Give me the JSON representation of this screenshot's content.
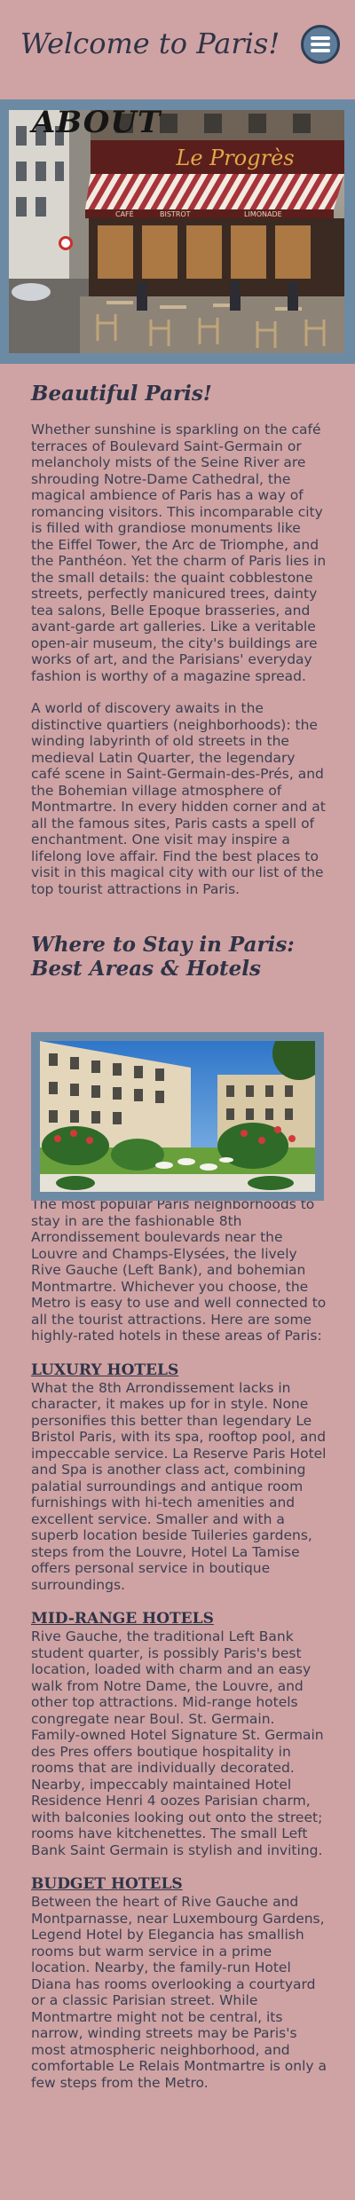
{
  "header": {
    "title": "Welcome to Paris!"
  },
  "hero": {
    "label": "ABOUT"
  },
  "sections": {
    "beautiful": {
      "heading": "Beautiful Paris!",
      "p1": "Whether sunshine is sparkling on the café terraces of Boulevard Saint-Germain or melancholy mists of the Seine River are shrouding Notre-Dame Cathedral, the magical ambience of Paris has a way of romancing visitors. This incomparable city is filled with grandiose monuments like the Eiffel Tower, the Arc de Triomphe, and the Panthéon. Yet the charm of Paris lies in the small details: the quaint cobblestone streets, perfectly manicured trees, dainty tea salons, Belle Epoque brasseries, and avant-garde art galleries. Like a veritable open-air museum, the city's buildings are works of art, and the Parisians' everyday fashion is worthy of a magazine spread.",
      "p2": "A world of discovery awaits in the distinctive quartiers (neighborhoods): the winding labyrinth of old streets in the medieval Latin Quarter, the legendary café scene in Saint-Germain-des-Prés, and the Bohemian village atmosphere of Montmartre. In every hidden corner and at all the famous sites, Paris casts a spell of enchantment. One visit may inspire a lifelong love affair. Find the best places to visit in this magical city with our list of the top tourist attractions in Paris."
    },
    "stay": {
      "heading_line1": "Where to Stay in Paris:",
      "heading_line2": "Best Areas & Hotels",
      "intro": "The most popular Paris neighborhoods to stay in are the fashionable 8th Arrondissement boulevards near the Louvre and Champs-Elysées, the lively Rive Gauche (Left Bank), and bohemian Montmartre. Whichever you choose, the Metro is easy to use and well connected to all the tourist attractions. Here are some highly-rated hotels in these areas of Paris:",
      "luxury_heading": "LUXURY HOTELS",
      "luxury_text": "What the 8th Arrondissement lacks in character, it makes up for in style. None personifies this better than legendary Le Bristol Paris, with its spa, rooftop pool, and impeccable service. La Reserve Paris Hotel and Spa is another class act, combining palatial surroundings and antique room furnishings with hi-tech amenities and excellent service. Smaller and with a superb location beside Tuileries gardens, steps from the Louvre, Hotel La Tamise offers personal service in boutique surroundings.",
      "midrange_heading": "MID-RANGE HOTELS",
      "midrange_text": "Rive Gauche, the traditional Left Bank student quarter, is possibly Paris's best location, loaded with charm and an easy walk from Notre Dame, the Louvre, and other top attractions. Mid-range hotels congregate near Boul. St. Germain. Family-owned Hotel Signature St. Germain des Pres offers boutique hospitality in rooms that are individually decorated. Nearby, impeccably maintained Hotel Residence Henri 4 oozes Parisian charm, with balconies looking out onto the street; rooms have kitchenettes. The small Left Bank Saint Germain is stylish and inviting.",
      "budget_heading": "BUDGET HOTELS",
      "budget_text": "Between the heart of Rive Gauche and Montparnasse, near Luxembourg Gardens, Legend Hotel by Elegancia has smallish rooms but warm service in a prime location. Nearby, the family-run Hotel Diana has rooms overlooking a courtyard or a classic Parisian street. While Montmartre might not be central, its narrow, winding streets may be Paris's most atmospheric neighborhood, and comfortable Le Relais Montmartre is only a few steps from the Metro."
    }
  },
  "cafe_sign": {
    "name": "Le Progrès",
    "awning_left": "CAFÉ",
    "awning_mid": "BISTROT",
    "awning_right": "LIMONADE"
  },
  "colors": {
    "background": "#cfa3a3",
    "frame": "#6d8aa4",
    "text": "#3b3f52",
    "menu_button": "#5d7d9b"
  }
}
